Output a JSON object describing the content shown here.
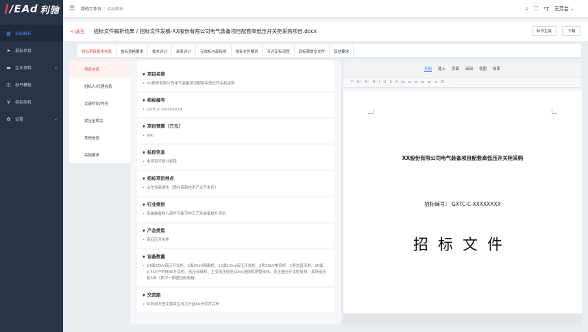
{
  "sidebar": {
    "logo": "/EAd",
    "logo_suffix": "利驰",
    "items": [
      {
        "label": "招标解析",
        "icon": "grid-icon",
        "active": true
      },
      {
        "label": "投标项目",
        "icon": "send-icon"
      },
      {
        "label": "企业资料",
        "icon": "folder-icon",
        "chevron": "⌄"
      },
      {
        "label": "标书模板",
        "icon": "book-icon"
      },
      {
        "label": "招标商机",
        "icon": "yen-icon"
      },
      {
        "label": "设置",
        "icon": "gear-icon",
        "chevron": "⌄"
      }
    ]
  },
  "topbar": {
    "breadcrumb": [
      "我的工作台",
      "招标解析"
    ],
    "user": "王芳芸 ⌄"
  },
  "header": {
    "back": "< 返回",
    "title": "招标文件解析结果 / 招标文件发稿-XX股份有限公司电气装备项目配套高低压开关柜采购项目.docx",
    "btn_generate": "标书生成",
    "btn_download": "下载"
  },
  "tabs": [
    "招标项目基本信息",
    "投标资格要求",
    "技术评分",
    "商务评分",
    "无效标与废标项",
    "投标文件要求",
    "开评定标流程",
    "后标需提交文件",
    "其他要求"
  ],
  "left_nav": [
    "项目信息",
    "招标人/代理信息",
    "关键时间/内容",
    "保证金相关",
    "其他信息",
    "采购要求"
  ],
  "sections": [
    {
      "h": "项目名称",
      "v": "XX股份有限公司电气装备项目配套高低压开关柜采购"
    },
    {
      "h": "招标编号",
      "v": "GXTC-C-XXXXXXXX"
    },
    {
      "h": "项目预算（万元）",
      "v": "990"
    },
    {
      "h": "标段信息",
      "v": "本项目不划分标段"
    },
    {
      "h": "招标项目地点",
      "v": "山东省高城市（德州高新技术产业开发区）"
    },
    {
      "h": "行业类别",
      "v": "高端装备核心部件节能节材工艺及装备提升项目"
    },
    {
      "h": "产品类型",
      "v": "高低压开关柜"
    },
    {
      "h": "设备数量",
      "v": "14面35kV高压开关柜、2面35kV隔离柜、12面10kV高压开关柜、2套10kV电容柜、1套交直流屏、26面0.4kV户内MNS开关柜、低压母线桥、主变低压侧至10kV进线柜铜管母线、变压器至开关柜母排、现场低压柜5面（其中一面壁挂配电箱）"
    },
    {
      "h": "交货期",
      "v": "合同双方签字盖章生效之日起60天供货完毕"
    }
  ],
  "doc": {
    "tabs": [
      "开始",
      "插入",
      "页面",
      "审阅",
      "视图",
      "效率"
    ],
    "toolbar": [
      "↶",
      "A⁺",
      "A⁻",
      "B",
      "I",
      "U",
      "S",
      "A",
      "⇆",
      "≡",
      "≡",
      "≡",
      "≡",
      "≡",
      "☰",
      "⋯"
    ],
    "title": "XX股份有限公司电气装备项目配套高低压开关柜采购",
    "code": "招标编号：  GXTC-C-XXXXXXXX",
    "big": "招标文件"
  }
}
